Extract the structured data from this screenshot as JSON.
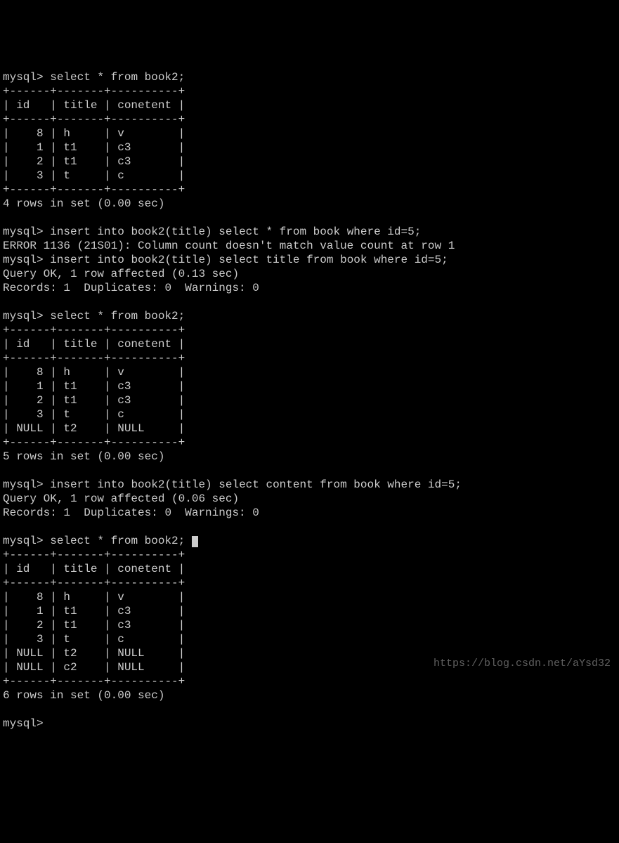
{
  "prompt": "mysql>",
  "table_border": {
    "sep": "+------+-------+----------+",
    "head": "| id   | title | conetent |"
  },
  "block1": {
    "cmd": "select * from book2;",
    "rows": [
      "|    8 | h     | v        |",
      "|    1 | t1    | c3       |",
      "|    2 | t1    | c3       |",
      "|    3 | t     | c        |"
    ],
    "summary": "4 rows in set (0.00 sec)"
  },
  "insert1": {
    "cmd": "insert into book2(title) select * from book where id=5;",
    "error": "ERROR 1136 (21S01): Column count doesn't match value count at row 1"
  },
  "insert2": {
    "cmd": "insert into book2(title) select title from book where id=5;",
    "ok": "Query OK, 1 row affected (0.13 sec)",
    "records": "Records: 1  Duplicates: 0  Warnings: 0"
  },
  "block2": {
    "cmd": "select * from book2;",
    "rows": [
      "|    8 | h     | v        |",
      "|    1 | t1    | c3       |",
      "|    2 | t1    | c3       |",
      "|    3 | t     | c        |",
      "| NULL | t2    | NULL     |"
    ],
    "summary": "5 rows in set (0.00 sec)"
  },
  "insert3": {
    "cmd": "insert into book2(title) select content from book where id=5;",
    "ok": "Query OK, 1 row affected (0.06 sec)",
    "records": "Records: 1  Duplicates: 0  Warnings: 0"
  },
  "block3": {
    "cmd": "select * from book2;",
    "cursor_after": true,
    "rows": [
      "|    8 | h     | v        |",
      "|    1 | t1    | c3       |",
      "|    2 | t1    | c3       |",
      "|    3 | t     | c        |",
      "| NULL | t2    | NULL     |",
      "| NULL | c2    | NULL     |"
    ],
    "summary": "6 rows in set (0.00 sec)"
  },
  "final_prompt": "mysql>",
  "watermark": "https://blog.csdn.net/aYsd32"
}
